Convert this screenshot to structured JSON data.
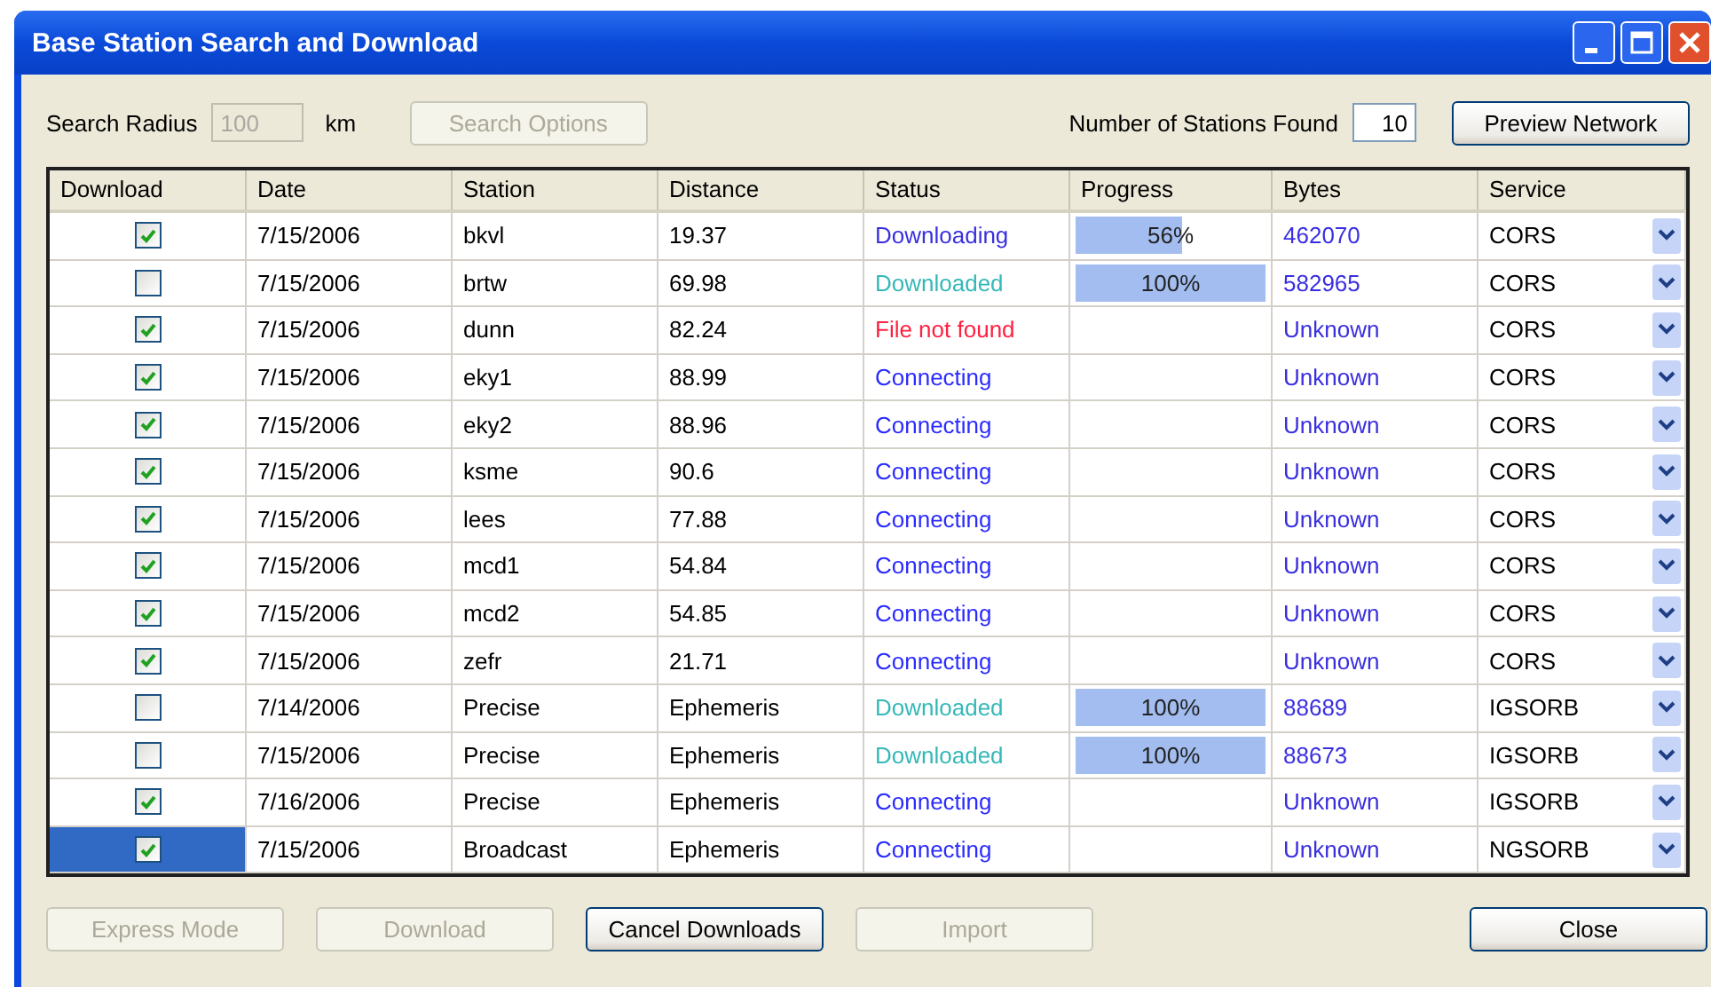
{
  "window": {
    "title": "Base Station Search and Download"
  },
  "search_radius": {
    "label": "Search Radius",
    "value": "100",
    "disabled": true,
    "unit": "km"
  },
  "search_options_button": {
    "label": "Search Options",
    "disabled": true
  },
  "stations_found": {
    "label": "Number of Stations Found",
    "value": "10"
  },
  "preview_button": {
    "label": "Preview Network",
    "disabled": false
  },
  "table": {
    "columns": [
      "Download",
      "Date",
      "Station",
      "Distance",
      "Status",
      "Progress",
      "Bytes",
      "Service"
    ],
    "rows": [
      {
        "checked": true,
        "selected": false,
        "date": "7/15/2006",
        "station": "bkvl",
        "distance": "19.37",
        "status": {
          "text": "Downloading",
          "color": "#3a2fe0"
        },
        "progress": {
          "level": 0.56,
          "label": "56%"
        },
        "bytes": "462070",
        "service": "CORS"
      },
      {
        "checked": false,
        "selected": false,
        "date": "7/15/2006",
        "station": "brtw",
        "distance": "69.98",
        "status": {
          "text": "Downloaded",
          "color": "#35b8b8"
        },
        "progress": {
          "level": 1,
          "label": "100%"
        },
        "bytes": "582965",
        "service": "CORS"
      },
      {
        "checked": true,
        "selected": false,
        "date": "7/15/2006",
        "station": "dunn",
        "distance": "82.24",
        "status": {
          "text": "File not found",
          "color": "#ff2040"
        },
        "bytes": "Unknown",
        "service": "CORS"
      },
      {
        "checked": true,
        "selected": false,
        "date": "7/15/2006",
        "station": "eky1",
        "distance": "88.99",
        "status": {
          "text": "Connecting",
          "color": "#2b2bff"
        },
        "bytes": "Unknown",
        "service": "CORS"
      },
      {
        "checked": true,
        "selected": false,
        "date": "7/15/2006",
        "station": "eky2",
        "distance": "88.96",
        "status": {
          "text": "Connecting",
          "color": "#2b2bff"
        },
        "bytes": "Unknown",
        "service": "CORS"
      },
      {
        "checked": true,
        "selected": false,
        "date": "7/15/2006",
        "station": "ksme",
        "distance": "90.6",
        "status": {
          "text": "Connecting",
          "color": "#2b2bff"
        },
        "bytes": "Unknown",
        "service": "CORS"
      },
      {
        "checked": true,
        "selected": false,
        "date": "7/15/2006",
        "station": "lees",
        "distance": "77.88",
        "status": {
          "text": "Connecting",
          "color": "#2b2bff"
        },
        "bytes": "Unknown",
        "service": "CORS"
      },
      {
        "checked": true,
        "selected": false,
        "date": "7/15/2006",
        "station": "mcd1",
        "distance": "54.84",
        "status": {
          "text": "Connecting",
          "color": "#2b2bff"
        },
        "bytes": "Unknown",
        "service": "CORS"
      },
      {
        "checked": true,
        "selected": false,
        "date": "7/15/2006",
        "station": "mcd2",
        "distance": "54.85",
        "status": {
          "text": "Connecting",
          "color": "#2b2bff"
        },
        "bytes": "Unknown",
        "service": "CORS"
      },
      {
        "checked": true,
        "selected": false,
        "date": "7/15/2006",
        "station": "zefr",
        "distance": "21.71",
        "status": {
          "text": "Connecting",
          "color": "#2b2bff"
        },
        "bytes": "Unknown",
        "service": "CORS"
      },
      {
        "checked": false,
        "selected": false,
        "date": "7/14/2006",
        "station": "Precise",
        "distance": "Ephemeris",
        "status": {
          "text": "Downloaded",
          "color": "#35b8b8"
        },
        "progress": {
          "level": 1,
          "label": "100%"
        },
        "bytes": "88689",
        "service": "IGSORB"
      },
      {
        "checked": false,
        "selected": false,
        "date": "7/15/2006",
        "station": "Precise",
        "distance": "Ephemeris",
        "status": {
          "text": "Downloaded",
          "color": "#35b8b8"
        },
        "progress": {
          "level": 1,
          "label": "100%"
        },
        "bytes": "88673",
        "service": "IGSORB"
      },
      {
        "checked": true,
        "selected": false,
        "date": "7/16/2006",
        "station": "Precise",
        "distance": "Ephemeris",
        "status": {
          "text": "Connecting",
          "color": "#2b2bff"
        },
        "bytes": "Unknown",
        "service": "IGSORB"
      },
      {
        "checked": true,
        "selected": true,
        "date": "7/15/2006",
        "station": "Broadcast",
        "distance": "Ephemeris",
        "status": {
          "text": "Connecting",
          "color": "#2b2bff"
        },
        "bytes": "Unknown",
        "service": "NGSORB"
      }
    ]
  },
  "buttons": [
    {
      "label": "Express Mode",
      "disabled": true
    },
    {
      "label": "Download",
      "disabled": true
    },
    {
      "label": "Cancel Downloads",
      "disabled": false
    },
    {
      "label": "Import",
      "disabled": true
    },
    {
      "label": "Close",
      "disabled": false
    }
  ]
}
